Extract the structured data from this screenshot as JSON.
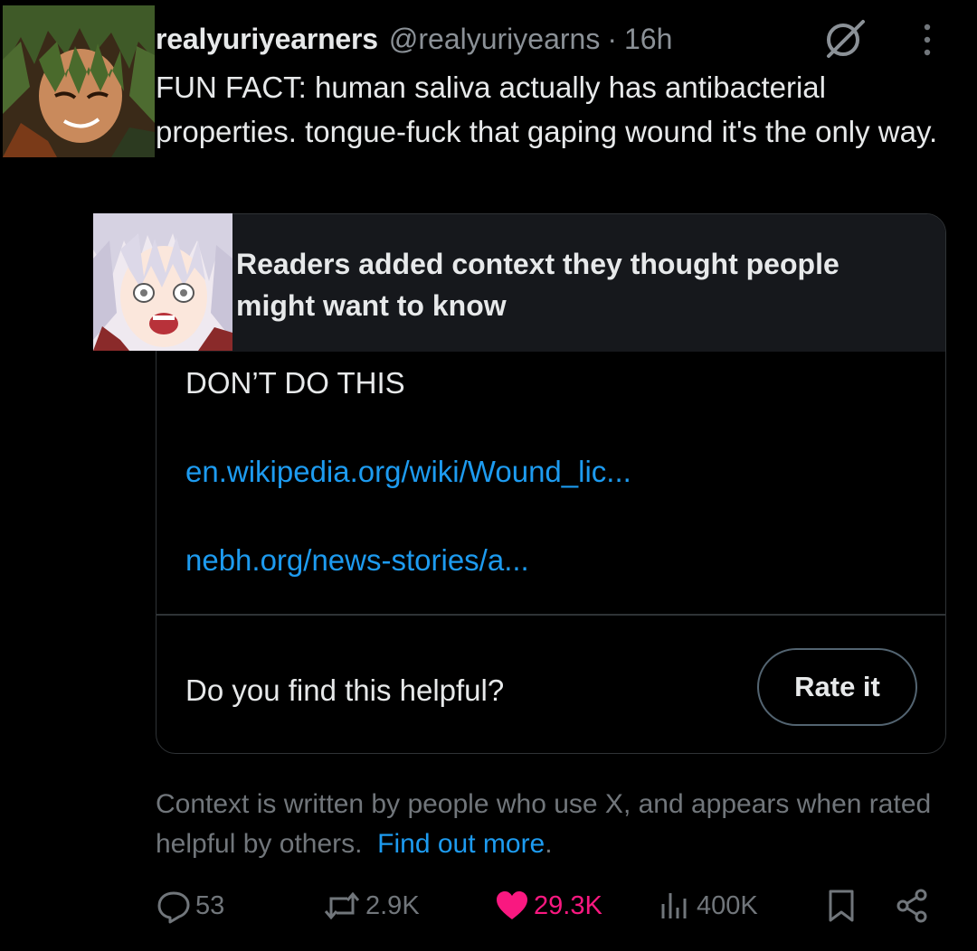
{
  "tweet": {
    "display_name": "realyuriyearners",
    "handle": "@realyuriyearns",
    "separator": "·",
    "time": "16h",
    "text": "FUN FACT: human saliva actually has antibacterial properties. tongue-fuck that gaping wound it's the only way."
  },
  "note": {
    "title": "Readers added context they thought people might want to know",
    "text": "DON’T DO THIS",
    "links": [
      "en.wikipedia.org/wiki/Wound_lic...",
      "nebh.org/news-stories/a..."
    ],
    "helpful_question": "Do you find this helpful?",
    "rate_button": "Rate it"
  },
  "context_footer": {
    "text": "Context is written by people who use X, and appears when rated helpful by others.",
    "link": "Find out more",
    "end": "."
  },
  "actions": {
    "replies": "53",
    "reposts": "2.9K",
    "likes": "29.3K",
    "views": "400K"
  },
  "icons": {
    "grok": "grok-icon",
    "more": "more-icon",
    "reply": "reply-icon",
    "repost": "repost-icon",
    "like": "heart-icon",
    "views": "views-icon",
    "bookmark": "bookmark-icon",
    "share": "share-icon"
  },
  "colors": {
    "background": "#000000",
    "text": "#e7e9ea",
    "secondary": "#71767b",
    "link": "#1d9bf0",
    "like": "#f91880",
    "border": "#2f3336",
    "note_header_bg": "#16181c"
  }
}
